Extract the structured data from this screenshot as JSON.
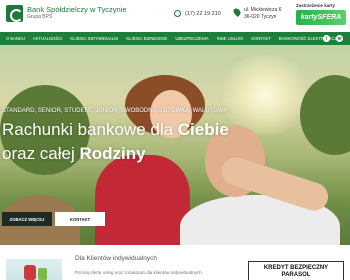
{
  "header": {
    "bank_name": "Bank Spółdzielczy w Tyczynie",
    "group": "Grupa BPS",
    "phone": "(17) 22 19 210",
    "address_line1": "ul. Mickiewicza 6",
    "address_line2": "36-020 Tyczyn",
    "card_promo_label": "Zastrzeżenie karty",
    "card_badge": "kartySFERA"
  },
  "nav": {
    "items": [
      "O BANKU",
      "AKTUALNOŚCI",
      "KLIENCI INDYWIDUALNI",
      "KLIENCI BIZNESOWI",
      "UBEZPIECZENIA",
      "INNE USŁUGI",
      "KONTAKT",
      "BANKOWOŚĆ ELEKTRONICZNA"
    ],
    "facebook_icon": "f",
    "chat_icon": "✉"
  },
  "hero": {
    "tags": "STANDARD, SENIOR, STUDENT, JUNIOR, SWOBODNA GOTÓWKA, WALUTOWY",
    "title_line1_plain": "Rachunki bankowe dla ",
    "title_line1_bold": "Ciebie",
    "title_line2_plain": "oraz całej ",
    "title_line2_bold": "Rodziny",
    "btn_more": "ZOBACZ WIĘCEJ",
    "btn_contact": "KONTAKT"
  },
  "bottom": {
    "section_title": "Dla Klientów indywidualnych",
    "section_text": "Poznaj ofertę usług oraz rozwiązań dla klientów indywidualnych.",
    "credit_line1": "KREDYT BEZPIECZNY",
    "credit_line2": "PARASOL"
  }
}
